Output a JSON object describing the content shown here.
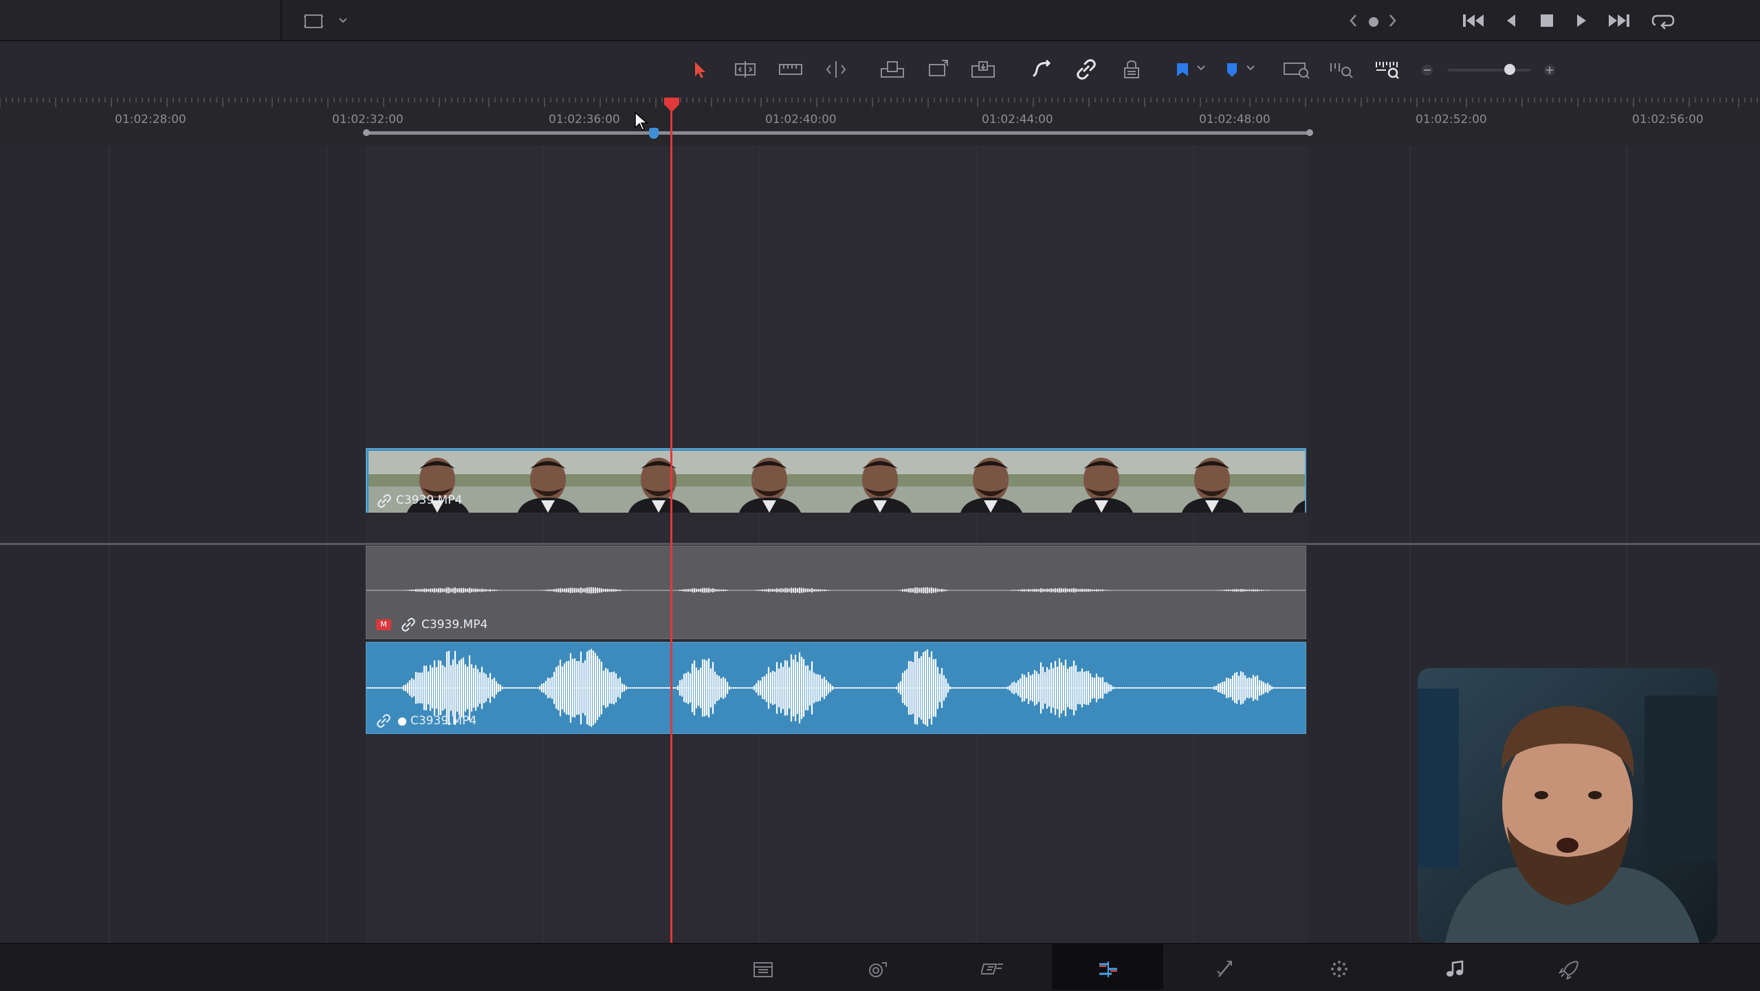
{
  "timeline": {
    "timecodes": [
      "01:02:28:00",
      "01:02:32:00",
      "01:02:36:00",
      "01:02:40:00",
      "01:02:44:00",
      "01:02:48:00",
      "01:02:52:00",
      "01:02:56:00"
    ]
  },
  "tracks": {
    "video_clip_name": "C3939.MP4",
    "audio_clip_1_name": "C3939.MP4",
    "audio_clip_1_mute_badge": "M",
    "audio_clip_2_name": "C3939.MP4"
  },
  "colors": {
    "playhead": "#e0393b",
    "clip_blue": "#3d8bbd",
    "audio_gray": "#5b5b5f",
    "flag_blue": "#2b7bea"
  },
  "icons": {
    "toolbar": [
      "selection-mode-icon",
      "trim-edit-icon",
      "dynamic-trim-icon",
      "blade-edit-icon",
      "insert-clip-icon",
      "overwrite-clip-icon",
      "replace-clip-icon",
      "snapping-icon",
      "linked-selection-icon",
      "position-lock-icon",
      "flag-icon",
      "marker-icon",
      "full-extent-zoom-icon",
      "detail-zoom-icon",
      "custom-zoom-icon"
    ],
    "transport": [
      "go-to-start-icon",
      "reverse-play-icon",
      "stop-icon",
      "play-icon",
      "go-to-end-icon",
      "loop-icon"
    ],
    "pages": [
      "media-page-icon",
      "cut-page-icon",
      "edit-page-icon",
      "fusion-page-icon",
      "color-page-icon",
      "fairlight-page-icon",
      "deliver-page-icon"
    ]
  },
  "zoom_level": 0.75
}
